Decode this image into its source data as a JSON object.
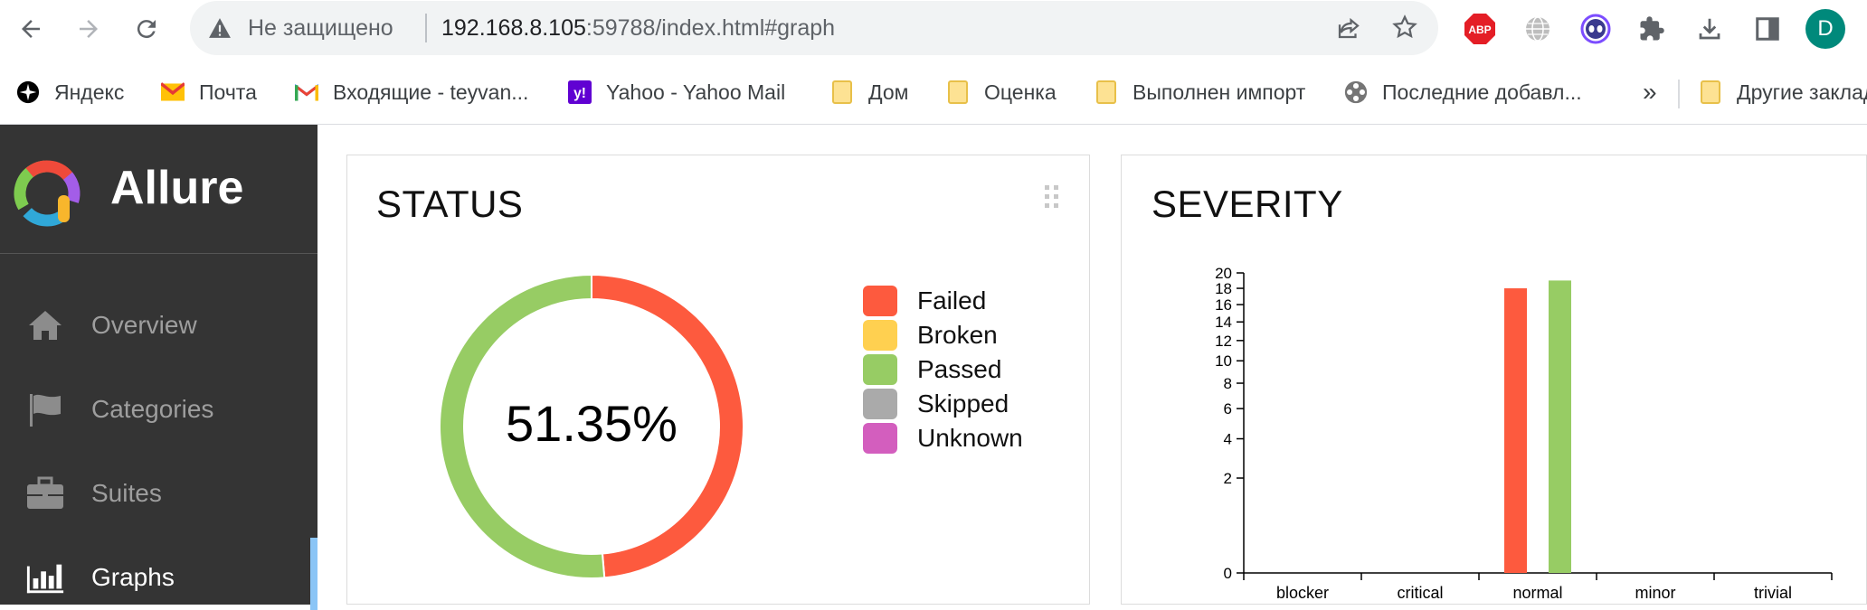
{
  "browser": {
    "security_label": "Не защищено",
    "url_host": "192.168.8.105",
    "url_rest": ":59788/index.html#graph",
    "profile_initial": "D",
    "abp_label": "ABP"
  },
  "bookmarks": {
    "items": [
      {
        "label": "Яндекс"
      },
      {
        "label": "Почта"
      },
      {
        "label": "Входящие - teyvan..."
      },
      {
        "label": "Yahoo - Yahoo Mail"
      },
      {
        "label": "Дом"
      },
      {
        "label": "Оценка"
      },
      {
        "label": "Выполнен импорт"
      },
      {
        "label": "Последние добавл..."
      }
    ],
    "more_label": "»",
    "other_label": "Другие закладки"
  },
  "sidebar": {
    "brand": "Allure",
    "items": [
      {
        "label": "Overview",
        "icon": "home-icon"
      },
      {
        "label": "Categories",
        "icon": "flag-icon"
      },
      {
        "label": "Suites",
        "icon": "briefcase-icon"
      },
      {
        "label": "Graphs",
        "icon": "bar-chart-icon",
        "active": true
      }
    ]
  },
  "status_widget": {
    "title": "STATUS",
    "center_text": "51.35%",
    "legend": [
      {
        "label": "Failed",
        "color": "#fd5a3e"
      },
      {
        "label": "Broken",
        "color": "#ffd050"
      },
      {
        "label": "Passed",
        "color": "#97cc64"
      },
      {
        "label": "Skipped",
        "color": "#aaaaaa"
      },
      {
        "label": "Unknown",
        "color": "#d35ebe"
      }
    ]
  },
  "severity_widget": {
    "title": "SEVERITY"
  },
  "chart_data": [
    {
      "type": "pie",
      "title": "STATUS",
      "categories": [
        "Failed",
        "Passed"
      ],
      "values": [
        48.65,
        51.35
      ],
      "colors": [
        "#fd5a3e",
        "#97cc64"
      ]
    },
    {
      "type": "bar",
      "title": "SEVERITY",
      "categories": [
        "blocker",
        "critical",
        "normal",
        "minor",
        "trivial"
      ],
      "series": [
        {
          "name": "Failed",
          "color": "#fd5a3e",
          "values": [
            0,
            0,
            18,
            0,
            0
          ]
        },
        {
          "name": "Passed",
          "color": "#97cc64",
          "values": [
            0,
            0,
            19,
            0,
            0
          ]
        }
      ],
      "yticks": [
        0,
        2,
        4,
        6,
        8,
        10,
        12,
        14,
        16,
        18,
        20
      ],
      "ylim": [
        0,
        20
      ],
      "yscale": "sqrt"
    }
  ]
}
